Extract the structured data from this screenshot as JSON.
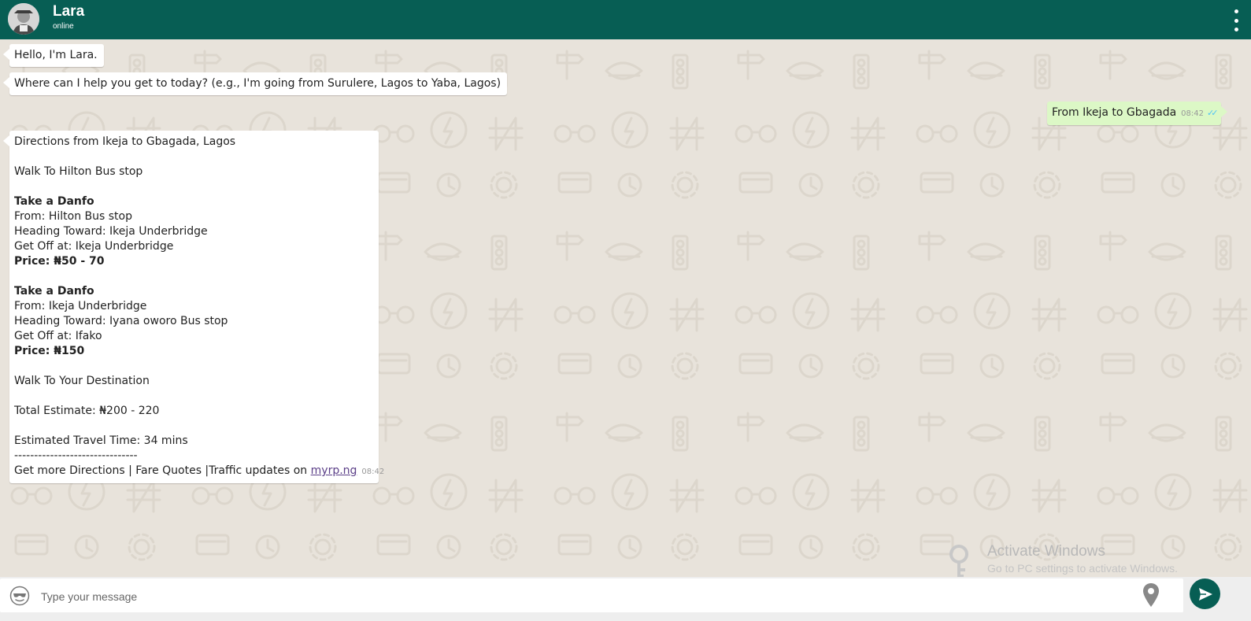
{
  "header": {
    "contact_name": "Lara",
    "status": "online",
    "avatar_icon": "user-avatar-icon",
    "menu_icon": "more-vert-icon"
  },
  "messages": {
    "greeting": "Hello, I'm Lara.",
    "prompt": "Where can I help you get to today? (e.g., I'm going from Surulere, Lagos to Yaba, Lagos)",
    "user": {
      "text": "From Ikeja to Gbagada",
      "time": "08:42",
      "ticks": "✓✓"
    },
    "directions": {
      "title": "Directions from Ikeja to Gbagada, Lagos",
      "walk_start": "Walk To Hilton Bus stop",
      "leg1": {
        "heading": "Take a Danfo",
        "from": "From: Hilton Bus stop",
        "toward": "Heading Toward: Ikeja Underbridge",
        "getoff": "Get Off at: Ikeja Underbridge",
        "price": "Price: ₦50 - 70"
      },
      "leg2": {
        "heading": "Take a Danfo",
        "from": "From: Ikeja Underbridge",
        "toward": "Heading Toward: Iyana oworo Bus stop",
        "getoff": "Get Off at: Ifako",
        "price": "Price: ₦150"
      },
      "walk_end": "Walk To Your Destination",
      "total": "Total Estimate: ₦200 - 220",
      "travel_time": "Estimated Travel Time: 34 mins",
      "divider": "-------------------------------",
      "footer": "Get more Directions | Fare Quotes |Traffic updates on ",
      "link": "myrp.ng",
      "time": "08:42"
    }
  },
  "watermark": {
    "title": "Activate Windows",
    "subtitle": "Go to PC settings to activate Windows."
  },
  "composer": {
    "placeholder": "Type your message",
    "emoji_icon": "sunglasses-emoji-icon",
    "location_icon": "location-pin-icon",
    "send_icon": "send-icon"
  },
  "colors": {
    "header_bg": "#075e54",
    "chat_bg": "#e8e3db",
    "outgoing_bubble": "#dcf8c6",
    "read_ticks": "#4fc3f7"
  }
}
